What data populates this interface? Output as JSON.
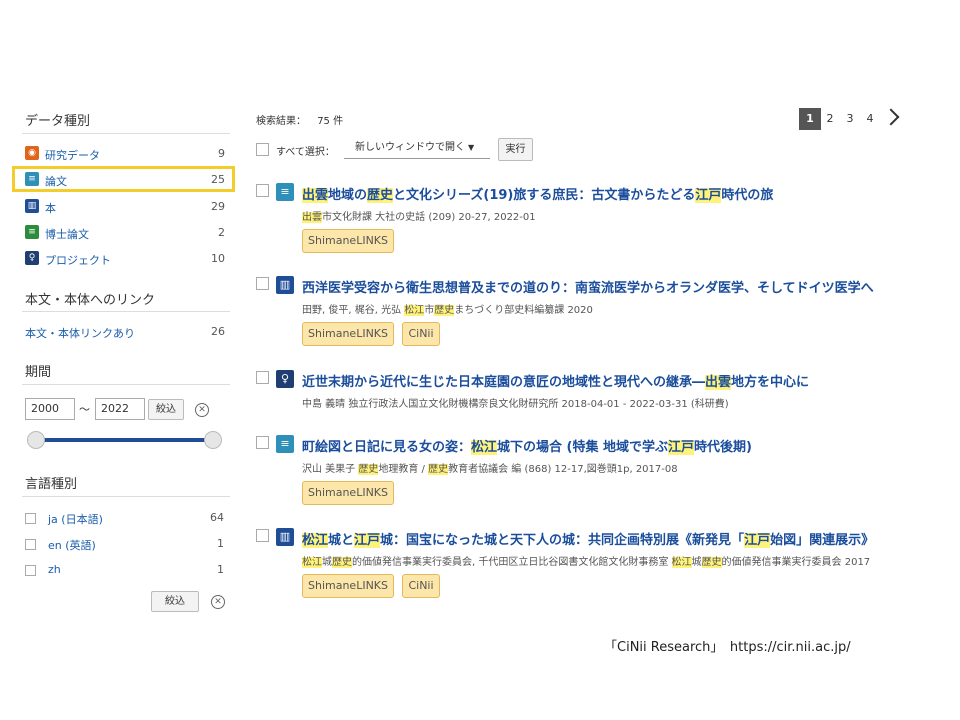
{
  "sidebar": {
    "data_type_heading": "データ種別",
    "data_types": [
      {
        "label": "研究データ",
        "count": "9",
        "icon": "research-data-icon",
        "color": "#e0641a"
      },
      {
        "label": "論文",
        "count": "25",
        "icon": "article-icon",
        "color": "#2e8fb8"
      },
      {
        "label": "本",
        "count": "29",
        "icon": "book-icon",
        "color": "#1f4e96"
      },
      {
        "label": "博士論文",
        "count": "2",
        "icon": "dissertation-icon",
        "color": "#2d8b3c"
      },
      {
        "label": "プロジェクト",
        "count": "10",
        "icon": "project-icon",
        "color": "#1f3f73"
      }
    ],
    "link_heading": "本文・本体へのリンク",
    "link_item": {
      "label": "本文・本体リンクあり",
      "count": "26"
    },
    "period_heading": "期間",
    "year_from": "2000",
    "tilde": "〜",
    "year_to": "2022",
    "narrow_button": "絞込",
    "language_heading": "言語種別",
    "languages": [
      {
        "label": "ja (日本語)",
        "count": "64"
      },
      {
        "label": "en (英語)",
        "count": "1"
      },
      {
        "label": "zh",
        "count": "1"
      }
    ],
    "language_narrow_button": "絞込"
  },
  "results_header": {
    "count_label": "検索結果：",
    "count_value": "75 件",
    "select_all": "すべて選択：",
    "open_option": "新しいウィンドウで開く",
    "run_button": "実行"
  },
  "pagination": {
    "pages": [
      "1",
      "2",
      "3",
      "4"
    ],
    "current": "1"
  },
  "results": [
    {
      "icon": "article-icon",
      "color": "#2e8fb8",
      "title_parts": [
        [
          "出雲",
          1
        ],
        [
          "地域の",
          0
        ],
        [
          "歴史",
          1
        ],
        [
          "と文化シリーズ(19)旅する庶民：古文書からたどる",
          0
        ],
        [
          "江戸",
          1
        ],
        [
          "時代の旅",
          0
        ]
      ],
      "meta_parts": [
        [
          "出雲",
          1
        ],
        [
          "市文化財課 大社の史話 (209) 20-27, 2022-01",
          0
        ]
      ],
      "badges": [
        "ShimaneLINKS"
      ]
    },
    {
      "icon": "book-icon",
      "color": "#1f4e96",
      "title_parts": [
        [
          "西洋医学受容から衛生思想普及までの道のり：南蛮流医学からオランダ医学、そしてドイツ医学へ",
          0
        ]
      ],
      "meta_parts": [
        [
          "田野, 俊平, 梶谷, 光弘 ",
          0
        ],
        [
          "松江",
          1
        ],
        [
          "市",
          0
        ],
        [
          "歴史",
          1
        ],
        [
          "まちづくり部史料編纂課 2020",
          0
        ]
      ],
      "badges": [
        "ShimaneLINKS",
        "CiNii"
      ]
    },
    {
      "icon": "project-icon",
      "color": "#1f3f73",
      "title_parts": [
        [
          "近世末期から近代に生じた日本庭園の意匠の地域性と現代への継承―",
          0
        ],
        [
          "出雲",
          1
        ],
        [
          "地方を中心に",
          0
        ]
      ],
      "meta_parts": [
        [
          "中島 義晴 独立行政法人国立文化財機構奈良文化財研究所 2018-04-01 - 2022-03-31 (科研費)",
          0
        ]
      ],
      "badges": []
    },
    {
      "icon": "article-icon",
      "color": "#2e8fb8",
      "title_parts": [
        [
          "町絵図と日記に見る女の姿：",
          0
        ],
        [
          "松江",
          1
        ],
        [
          "城下の場合 (特集 地域で学ぶ",
          0
        ],
        [
          "江戸",
          1
        ],
        [
          "時代後期)",
          0
        ]
      ],
      "meta_parts": [
        [
          "沢山 美果子 ",
          0
        ],
        [
          "歴史",
          1
        ],
        [
          "地理教育 / ",
          0
        ],
        [
          "歴史",
          1
        ],
        [
          "教育者協議会 編 (868) 12-17,図巻頭1p, 2017-08",
          0
        ]
      ],
      "badges": [
        "ShimaneLINKS"
      ]
    },
    {
      "icon": "book-icon",
      "color": "#1f4e96",
      "title_parts": [
        [
          "松江",
          1
        ],
        [
          "城と",
          0
        ],
        [
          "江戸",
          1
        ],
        [
          "城：国宝になった城と天下人の城：共同企画特別展《新発見「",
          0
        ],
        [
          "江戸",
          1
        ],
        [
          "始図」関連展示》",
          0
        ]
      ],
      "meta_parts": [
        [
          "松江",
          1
        ],
        [
          "城",
          0
        ],
        [
          "歴史",
          1
        ],
        [
          "的価値発信事業実行委員会, 千代田区立日比谷図書文化館文化財事務室 ",
          0
        ],
        [
          "松江",
          1
        ],
        [
          "城",
          0
        ],
        [
          "歴史",
          1
        ],
        [
          "的価値発信事業実行委員会 2017",
          0
        ]
      ],
      "badges": [
        "ShimaneLINKS",
        "CiNii"
      ]
    }
  ],
  "caption": "「CiNii Research」　https://cir.nii.ac.jp/"
}
